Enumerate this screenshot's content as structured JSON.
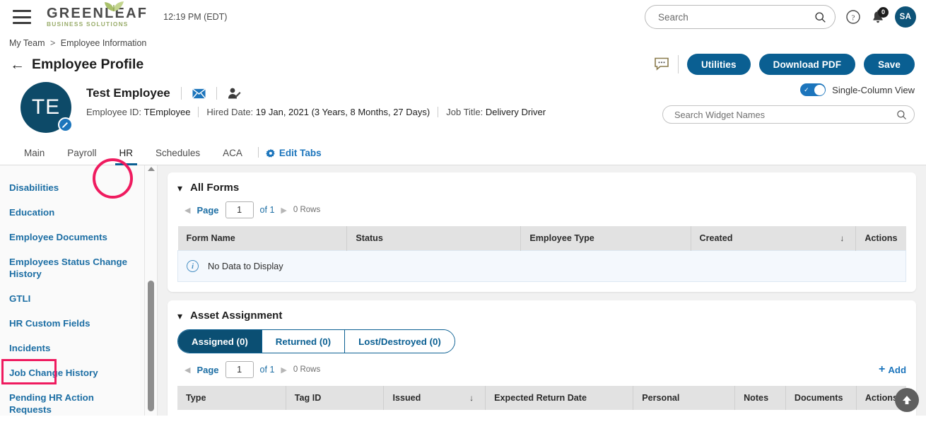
{
  "topbar": {
    "menu_icon": "hamburger-icon",
    "logo_main": "GREENLEAF",
    "logo_sub": "BUSINESS SOLUTIONS",
    "clock": "12:19 PM (EDT)",
    "search_placeholder": "Search",
    "search_value": "",
    "help_icon": "help-icon",
    "bell_icon": "bell-icon",
    "notification_count": "0",
    "avatar_initials": "SA"
  },
  "breadcrumb": {
    "item1": "My Team",
    "separator": ">",
    "item2": "Employee Information"
  },
  "page": {
    "back_arrow": "←",
    "title": "Employee Profile",
    "comment_icon": "comment-icon",
    "buttons": {
      "utilities": "Utilities",
      "download_pdf": "Download PDF",
      "save": "Save"
    }
  },
  "employee": {
    "avatar_initials": "TE",
    "name": "Test Employee",
    "email_icon": "envelope-icon",
    "impersonate_icon": "user-edit-icon",
    "id_label": "Employee ID:",
    "id_value": "TEmployee",
    "hired_label": "Hired Date:",
    "hired_value": "19 Jan, 2021 (3 Years, 8 Months, 27 Days)",
    "job_label": "Job Title:",
    "job_value": "Delivery Driver",
    "toggle_label": "Single-Column View",
    "toggle_on": true,
    "widget_search_placeholder": "Search Widget Names",
    "widget_search_value": ""
  },
  "tabs": {
    "items": [
      {
        "label": "Main",
        "active": false
      },
      {
        "label": "Payroll",
        "active": false
      },
      {
        "label": "HR",
        "active": true
      },
      {
        "label": "Schedules",
        "active": false
      },
      {
        "label": "ACA",
        "active": false
      }
    ],
    "edit_tabs": "Edit Tabs",
    "gear_icon": "gear-icon"
  },
  "sidebar": {
    "items": [
      {
        "label": "Disabilities"
      },
      {
        "label": "Education"
      },
      {
        "label": "Employee Documents"
      },
      {
        "label": "Employees Status Change History"
      },
      {
        "label": "GTLI"
      },
      {
        "label": "HR Custom Fields"
      },
      {
        "label": "Incidents"
      },
      {
        "label": "Job Change History"
      },
      {
        "label": "Pending HR Action Requests"
      }
    ]
  },
  "all_forms": {
    "title": "All Forms",
    "collapse_icon": "chevron-down-icon",
    "pager": {
      "prev": "◀",
      "page_label": "Page",
      "page_value": "1",
      "of_text": "of 1",
      "next": "▶",
      "rows_text": "0 Rows"
    },
    "columns": [
      "Form Name",
      "Status",
      "Employee Type",
      "Created",
      "Actions"
    ],
    "sorted_column": "Created",
    "sort_icon": "↓",
    "empty_message": "No Data to Display",
    "info_icon": "info-icon"
  },
  "asset_assignment": {
    "title": "Asset Assignment",
    "collapse_icon": "chevron-down-icon",
    "segments": [
      {
        "label": "Assigned (0)",
        "active": true
      },
      {
        "label": "Returned (0)",
        "active": false
      },
      {
        "label": "Lost/Destroyed (0)",
        "active": false
      }
    ],
    "pager": {
      "prev": "◀",
      "page_label": "Page",
      "page_value": "1",
      "of_text": "of 1",
      "next": "▶",
      "rows_text": "0 Rows"
    },
    "add_label": "Add",
    "add_icon": "plus-icon",
    "columns": [
      "Type",
      "Tag ID",
      "Issued",
      "Expected Return Date",
      "Personal",
      "Notes",
      "Documents",
      "Actions"
    ],
    "sorted_column": "Issued",
    "sort_icon": "↓"
  },
  "scroll_top": {
    "icon": "arrow-up-icon"
  },
  "annotations": {
    "circle_target": "HR",
    "rect_target": "Incidents",
    "color": "#ef1b5f"
  },
  "colors": {
    "primary_blue": "#0a5f92",
    "dark_blue": "#0b4f73",
    "link_blue": "#1c6ea4",
    "accent_pink": "#ef1b5f",
    "leaf_green": "#9aad6b"
  }
}
